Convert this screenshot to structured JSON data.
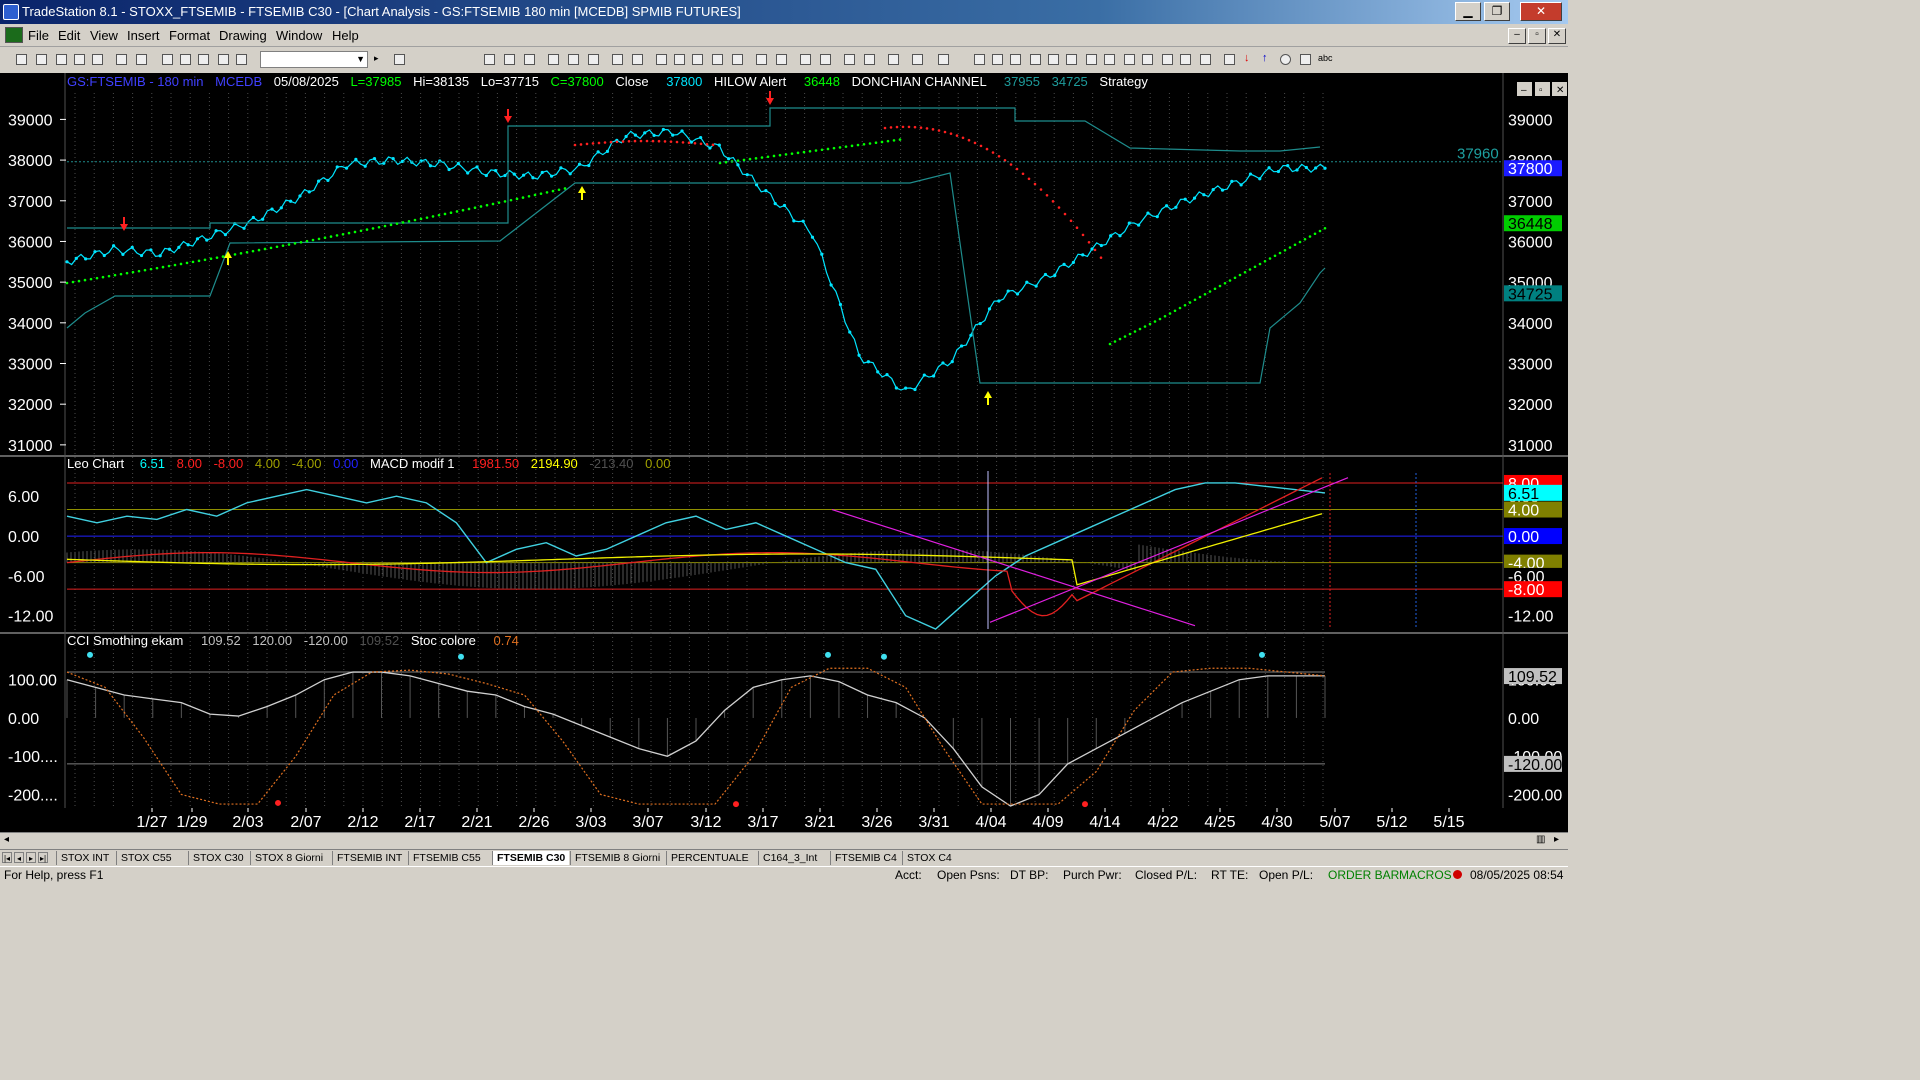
{
  "window": {
    "title": "TradeStation 8.1 - STOXX_FTSEMIB - FTSEMIB C30 - [Chart Analysis - GS:FTSEMIB  180 min  [MCEDB] SPMIB FUTURES]",
    "min": "▁",
    "max": "❐",
    "close": "✕"
  },
  "menu": [
    "File",
    "Edit",
    "View",
    "Insert",
    "Format",
    "Drawing",
    "Window",
    "Help"
  ],
  "mdi": [
    "‒",
    "▫",
    "✕"
  ],
  "panel_buttons": [
    "‒",
    "▫",
    "✕"
  ],
  "price_header": {
    "symbol": "GS:FTSEMIB - 180 min",
    "feed": "MCEDB",
    "date": "05/08/2025",
    "low_close": "L=37985",
    "hi": "Hi=38135",
    "lo": "Lo=37715",
    "c": "C=37800",
    "close_lbl": "Close",
    "close_val": "37800",
    "hilow_lbl": "HILOW Alert",
    "hilow_val": "36448",
    "donchian_lbl": "DONCHIAN CHANNEL",
    "don_hi": "37955",
    "don_lo": "34725",
    "strategy": "Strategy"
  },
  "leo_header": {
    "name": "Leo Chart",
    "v1": "6.51",
    "v2": "8.00",
    "v3": "-8.00",
    "v4": "4.00",
    "v5": "-4.00",
    "v6": "0.00",
    "macd": "MACD modif 1",
    "m1": "1981.50",
    "m2": "2194.90",
    "m3": "-213.40",
    "m4": "0.00"
  },
  "cci_header": {
    "name": "CCI Smothing ekam",
    "v1": "109.52",
    "v2": "120.00",
    "v3": "-120.00",
    "v4": "109.52",
    "stoc": "Stoc colore",
    "stoc_val": "0.74"
  },
  "price_axis_labels": [
    "39000",
    "38000",
    "37000",
    "36000",
    "35000",
    "34000",
    "33000",
    "32000",
    "31000"
  ],
  "price_axis_values": [
    39000,
    38000,
    37000,
    36000,
    35000,
    34000,
    33000,
    32000,
    31000
  ],
  "price_tags": [
    {
      "text": "37800",
      "value": 37800,
      "bg": "#1a1aff",
      "fg": "#ffffff"
    },
    {
      "text": "36448",
      "value": 36448,
      "bg": "#00cc00",
      "fg": "#000000"
    },
    {
      "text": "34725",
      "value": 34725,
      "bg": "#008080",
      "fg": "#000000"
    }
  ],
  "price_line_label": "37960",
  "price_line_value": 37960,
  "leo_axis_labels": [
    "6.00",
    "0.00",
    "-6.00",
    "-12.00"
  ],
  "leo_axis_values": [
    6,
    0,
    -6,
    -12
  ],
  "leo_tags": [
    {
      "text": "8.00",
      "value": 8,
      "bg": "#ff0000",
      "fg": "#ffffff"
    },
    {
      "text": "6.51",
      "value": 6.51,
      "bg": "#00ffff",
      "fg": "#000000"
    },
    {
      "text": "4.00",
      "value": 4,
      "bg": "#808000",
      "fg": "#ffffff"
    },
    {
      "text": "0.00",
      "value": 0,
      "bg": "#0000ff",
      "fg": "#ffffff"
    },
    {
      "text": "-4.00",
      "value": -4,
      "bg": "#808000",
      "fg": "#ffffff"
    },
    {
      "text": "-6.00",
      "value": -6,
      "bg": "#000000",
      "fg": "#ffffff"
    },
    {
      "text": "-8.00",
      "value": -8,
      "bg": "#ff0000",
      "fg": "#ffffff"
    }
  ],
  "cci_axis_labels": [
    "100.00",
    "0.00",
    "-100....",
    "-200...."
  ],
  "cci_axis_values": [
    100,
    0,
    -100,
    -200
  ],
  "cci_right_labels": [
    "100.00",
    "0.00",
    "-100.00",
    "-200.00"
  ],
  "cci_tags": [
    {
      "text": "109.52",
      "value": 109.52,
      "bg": "#c0c0c0",
      "fg": "#000000"
    },
    {
      "text": "-120.00",
      "value": -120,
      "bg": "#c0c0c0",
      "fg": "#000000"
    }
  ],
  "x_labels": [
    "1/27",
    "1/29",
    "2/03",
    "2/07",
    "2/12",
    "2/17",
    "2/21",
    "2/26",
    "3/03",
    "3/07",
    "3/12",
    "3/17",
    "3/21",
    "3/26",
    "3/31",
    "4/04",
    "4/09",
    "4/14",
    "4/22",
    "4/25",
    "4/30",
    "5/07",
    "5/12",
    "5/15"
  ],
  "tabs": [
    "STOX INT",
    "STOX C55",
    "STOX C30",
    "STOX 8 Giorni",
    "FTSEMIB INT",
    "FTSEMIB C55",
    "FTSEMIB C30",
    "FTSEMIB 8 Giorni",
    "PERCENTUALE",
    "C164_3_Int",
    "FTSEMIB C4",
    "STOX C4"
  ],
  "active_tab": "FTSEMIB C30",
  "tab_nav": [
    "|◂",
    "◂",
    "▸",
    "▸|"
  ],
  "status": {
    "help": "For Help, press F1",
    "acct": "Acct:",
    "open_psns": "Open Psns:",
    "dt_bp": "DT BP:",
    "purch_pwr": "Purch Pwr:",
    "closed_pl": "Closed P/L:",
    "rt_te": "RT TE:",
    "open_pl": "Open P/L:",
    "order_bar": "ORDER BAR",
    "macros": "MACROS",
    "datetime": "08/05/2025 08:54"
  },
  "colors": {
    "price_line": "#00e5ff",
    "donchian": "#1e8c8c",
    "green_dots": "#00ff00",
    "red_dots": "#ff2020",
    "leo_cyan": "#40d0e0",
    "leo_red": "#e02020",
    "leo_yellow": "#f0f000",
    "trend_magenta": "#e020e0",
    "cci_white": "#d0d0d0",
    "cci_orange": "#e07020",
    "cci_red": "#e02020"
  },
  "chart_data": {
    "type": "line",
    "x_labels": [
      "1/27",
      "1/29",
      "2/03",
      "2/07",
      "2/12",
      "2/17",
      "2/21",
      "2/26",
      "3/03",
      "3/07",
      "3/12",
      "3/17",
      "3/21",
      "3/26",
      "3/31",
      "4/04",
      "4/09",
      "4/14",
      "4/22",
      "4/25",
      "4/30",
      "5/07"
    ],
    "price": [
      35500,
      35800,
      35700,
      36100,
      36500,
      37100,
      37900,
      38000,
      37900,
      37700,
      37600,
      37800,
      38600,
      38700,
      38300,
      37200,
      36200,
      33200,
      32300,
      33100,
      34600,
      35100,
      35800,
      36500,
      37000,
      37400,
      37800,
      37800
    ],
    "price_ylim": [
      30800,
      39600
    ],
    "leo_ylim": [
      -14,
      9.5
    ],
    "cci_ylim": [
      -230,
      175
    ],
    "arrows_up": [
      "1/31",
      "3/03",
      "4/04"
    ],
    "arrows_down": [
      "1/28",
      "2/24",
      "3/18"
    ]
  }
}
